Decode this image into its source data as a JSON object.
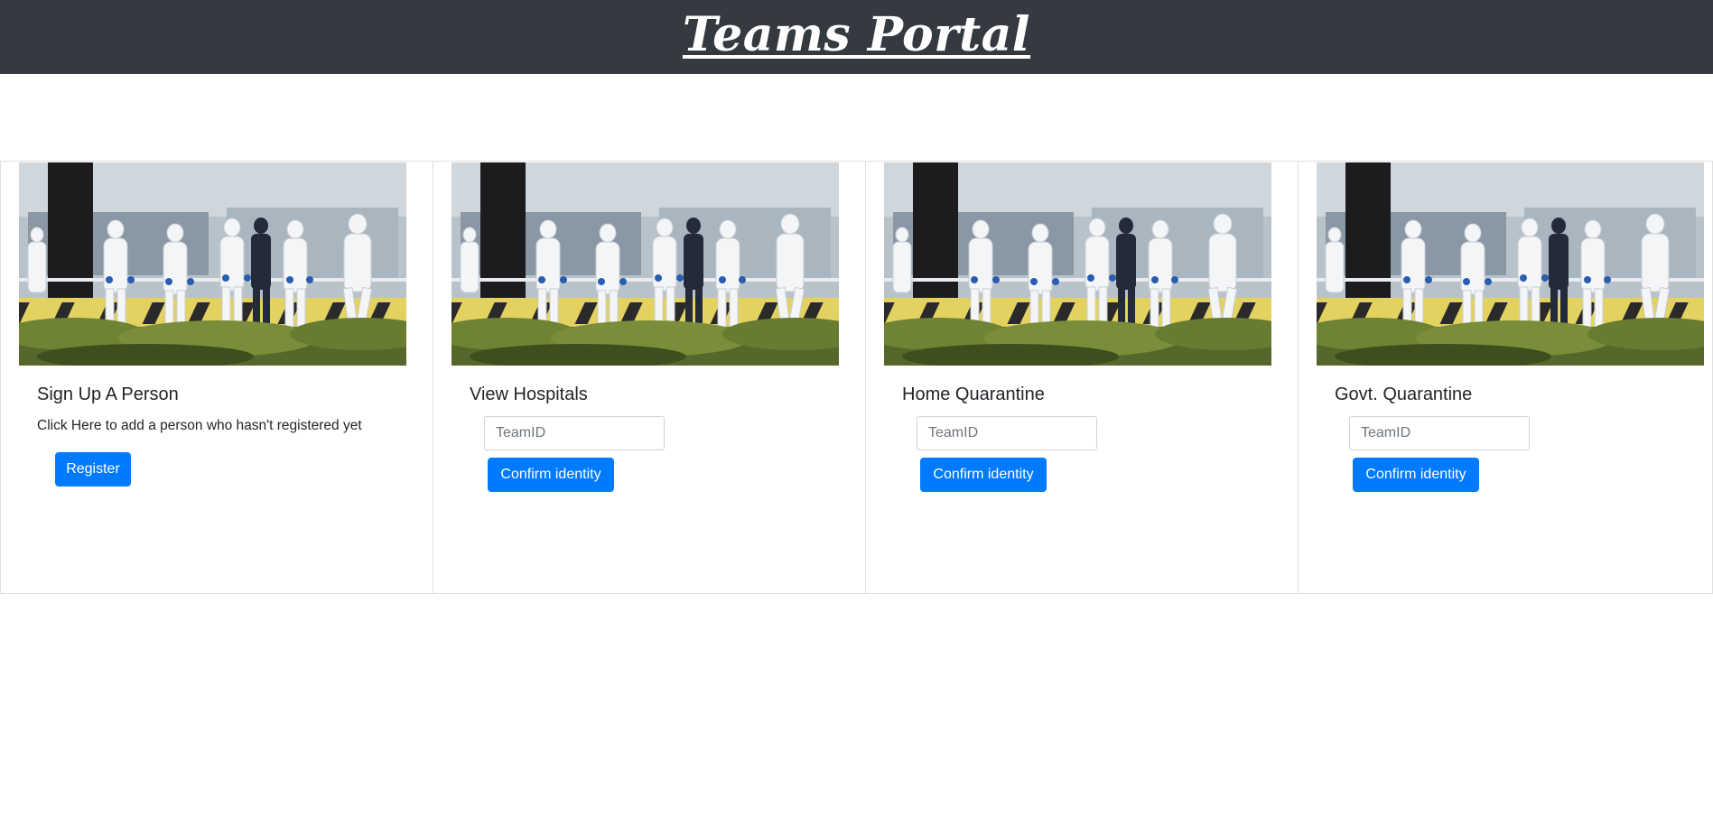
{
  "header": {
    "brand": "Teams Portal"
  },
  "cards": [
    {
      "title": "Sign Up A Person",
      "text": "Click Here to add a person who hasn't registered yet",
      "button_label": "Register"
    },
    {
      "title": "View Hospitals",
      "input_placeholder": "TeamID",
      "button_label": "Confirm identity"
    },
    {
      "title": "Home Quarantine",
      "input_placeholder": "TeamID",
      "button_label": "Confirm identity"
    },
    {
      "title": "Govt. Quarantine",
      "input_placeholder": "TeamID",
      "button_label": "Confirm identity"
    }
  ],
  "colors": {
    "navbar": "#343a40",
    "primary": "#007bff"
  }
}
